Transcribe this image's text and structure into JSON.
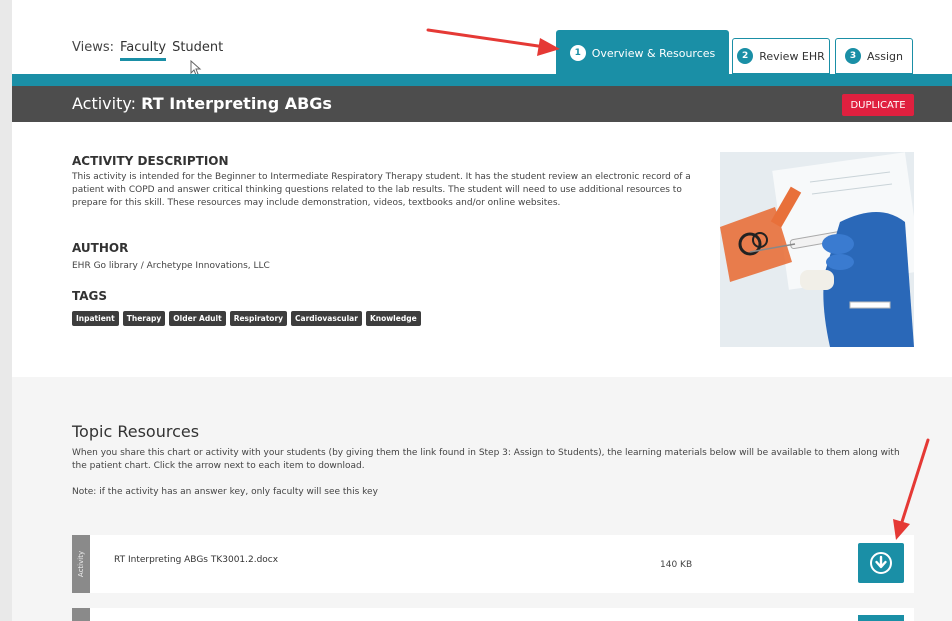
{
  "views": {
    "label": "Views:",
    "faculty": "Faculty",
    "student": "Student"
  },
  "tabs": [
    {
      "num": "1",
      "label": "Overview & Resources",
      "active": true
    },
    {
      "num": "2",
      "label": "Review EHR",
      "active": false
    },
    {
      "num": "3",
      "label": "Assign",
      "active": false
    }
  ],
  "activity": {
    "prefix": "Activity:",
    "name": "RT Interpreting ABGs",
    "duplicate_label": "DUPLICATE"
  },
  "description": {
    "heading": "ACTIVITY DESCRIPTION",
    "text": "This activity is intended for the Beginner to Intermediate Respiratory Therapy student. It has the student review an electronic record of a patient with COPD and answer critical thinking questions related to the lab results. The student will need to use additional resources to prepare for this skill. These resources may include demonstration, videos, textbooks and/or online websites."
  },
  "author": {
    "heading": "AUTHOR",
    "text": "EHR Go library / Archetype Innovations, LLC"
  },
  "tags": {
    "heading": "TAGS",
    "items": [
      "Inpatient",
      "Therapy",
      "Older Adult",
      "Respiratory",
      "Cardiovascular",
      "Knowledge"
    ]
  },
  "topic": {
    "title": "Topic Resources",
    "description": "When you share this chart or activity with your students (by giving them the link found in Step 3: Assign to Students), the learning materials below will be available to them along with the patient chart. Click the arrow next to each item to download.",
    "note": "Note: if the activity has an answer key, only faculty will see this key"
  },
  "resources": [
    {
      "category": "Activity",
      "name": "RT Interpreting ABGs TK3001.2.docx",
      "size": "140 KB"
    }
  ],
  "colors": {
    "accent": "#1a8fa6",
    "dark_bar": "#4d4d4d",
    "duplicate": "#e0203f",
    "annotation_arrow": "#e53935"
  }
}
